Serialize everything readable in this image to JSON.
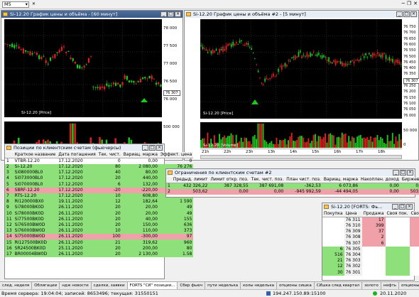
{
  "toolbar": {
    "interval": "M5"
  },
  "chart1": {
    "title": "Si-12.20 График цены и объёма - [60 минут]",
    "price_ticks": [
      "78 000",
      "77 500",
      "77 000",
      "76 500",
      "76 000"
    ],
    "vol_ticks": [
      "500 000",
      "0"
    ],
    "price_legend": "Si-12.20 [Price]",
    "last": "76 307"
  },
  "chart2": {
    "title": "Si-12.20 График цены и объёма #2 - [5 минут]",
    "price_ticks": [
      "76 750",
      "76 700",
      "76 650",
      "76 600",
      "76 550",
      "76 500",
      "76 450",
      "76 400",
      "76 350",
      "76 300",
      "76 250",
      "76 200",
      "76 150",
      "76 100",
      "76 050",
      "76 000"
    ],
    "vol_ticks": [
      "50 000",
      "0"
    ],
    "price_legend": "Si-12.20 [Price]",
    "vol_legend": "Si-12.20 [Volume]",
    "last": "76 307",
    "time_ticks": [
      "21h",
      "22h",
      "23h",
      "13h",
      "14h",
      "15h",
      "16h",
      "17h",
      "18h"
    ]
  },
  "positions": {
    "title": "Позиции по клиентским счетам (фьючерсы)",
    "headers": [
      "",
      "Краткое название",
      "Дата погашения",
      "Тек. чист.",
      "Вариац. маржа",
      "Эффект. цена"
    ],
    "rows": [
      [
        "1",
        "VTBR-12.20",
        "17.12.2020",
        "0",
        "0,00",
        "0"
      ],
      [
        "2",
        "Si-12.20",
        "17.12.2020",
        "80",
        "2 080,00",
        "76 276"
      ],
      [
        "3",
        "Si080000BL0",
        "17.12.2020",
        "40",
        "80,00",
        "297"
      ],
      [
        "4",
        "Si073000BL0",
        "17.12.2020",
        "20",
        "440,00",
        "4 365"
      ],
      [
        "5",
        "Si070000BL0",
        "17.12.2020",
        "6",
        "132,00",
        "6 298"
      ],
      [
        "6",
        "SBRF-12.20",
        "17.12.2020",
        "-20",
        "-220,00",
        "23 853"
      ],
      [
        "7",
        "RTS-12.20",
        "17.12.2020",
        "10",
        "608,80",
        "125 020"
      ],
      [
        "8",
        "RI120000BX0",
        "19.11.2020",
        "12",
        "182,64",
        "1 590"
      ],
      [
        "9",
        "Si78000BK0D",
        "26.11.2020",
        "20",
        "20,00",
        "49"
      ],
      [
        "10",
        "Si78000BK0D",
        "26.11.2020",
        "20",
        "20,00",
        "49"
      ],
      [
        "11",
        "Si77500BK0D",
        "26.11.2020",
        "20",
        "40,00",
        "155"
      ],
      [
        "12",
        "Si76500BW0D",
        "26.11.2020",
        "20",
        "150,00",
        "636"
      ],
      [
        "13",
        "Si76000BW0D",
        "26.11.2020",
        "10",
        "110,00",
        "373"
      ],
      [
        "14",
        "Si75000BW0D",
        "26.11.2020",
        "100",
        "-300,00",
        "97"
      ],
      [
        "15",
        "RI127500BK0D",
        "26.11.2020",
        "21",
        "319,62",
        "960"
      ],
      [
        "16",
        "SR24500BK0D",
        "25.11.2020",
        "20",
        "200,00",
        "80"
      ],
      [
        "17",
        "BR00004BW0D",
        "26.11.2020",
        "20",
        "2 130,00",
        "1.58"
      ]
    ]
  },
  "limits": {
    "title": "Ограничения по клиентским счетам #2",
    "headers": [
      "",
      "Предыд. лимит",
      "Лимит откр. поз.",
      "Тек. чист. поз.",
      "План чист. поз.",
      "Вариац. маржа",
      "Накоплен. доход",
      "Биржевые"
    ],
    "rows": [
      [
        "1",
        "432 326,22",
        "387 328,55",
        "387 691,08",
        "-362,53",
        "6 073,86",
        "0,00",
        "0,00"
      ],
      [
        "2",
        "503,62",
        "0,00",
        "0,00",
        "-945 992,59",
        "-44 494,05",
        "0,00",
        "503,62"
      ]
    ]
  },
  "orderbook": {
    "title": "Si-12.20 [FORTS: Фь...",
    "headers": [
      "Покупка",
      "Цена",
      "Продажа",
      "Своя пок.",
      "Своя пр."
    ],
    "rows": [
      [
        "",
        "76 311",
        "17"
      ],
      [
        "",
        "76 310",
        "399"
      ],
      [
        "",
        "76 309",
        "37"
      ],
      [
        "",
        "76 308",
        "2"
      ],
      [
        "",
        "76 307",
        "6"
      ],
      [
        "6",
        "76 305",
        ""
      ],
      [
        "516",
        "76 304",
        ""
      ],
      [
        "21",
        "76 303",
        ""
      ],
      [
        "12",
        "76 302",
        ""
      ],
      [
        "30",
        "76 301",
        ""
      ]
    ]
  },
  "taskbar": [
    "след. неделя",
    "Облигации",
    "ндж новости",
    "сделки, заявки",
    "FORTS \"СИ\" позиции...",
    "Сбер фьюч",
    "пути неделька",
    "колы неделька",
    "опционы сишка",
    "СИшка след квартал",
    "золото",
    "нефть",
    "опционы ртс"
  ],
  "status": {
    "server_time": "Время сервера: 19:04:04; записей: 8653496; текущая: 31550151",
    "ip": "194.247.150.89:15100",
    "date": "20.11.2020"
  },
  "colors": {
    "bull": "#1ec81e",
    "bear": "#e02020",
    "title_bar": "#3f5f8e",
    "positive_row": "#8ee07b",
    "negative_row": "#f0a0a8"
  }
}
